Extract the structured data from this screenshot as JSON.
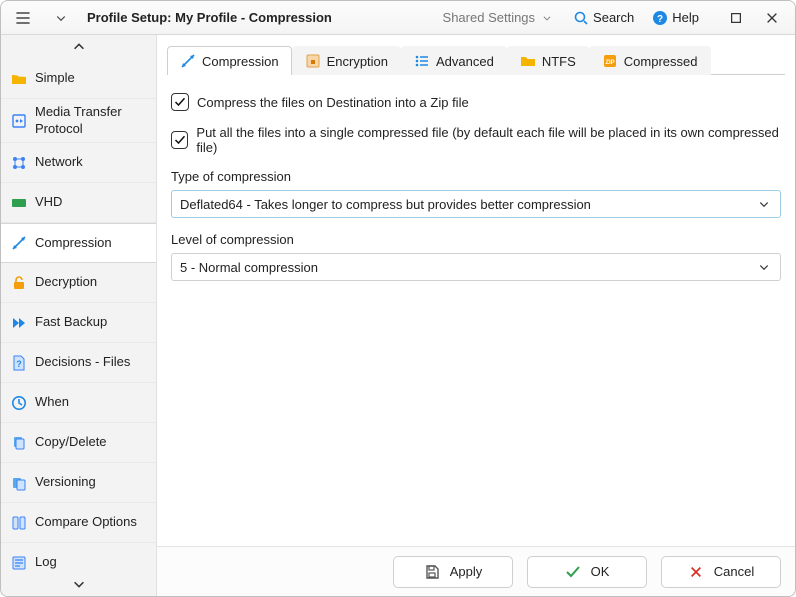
{
  "titlebar": {
    "title": "Profile Setup: My Profile - Compression",
    "shared": "Shared Settings",
    "search": "Search",
    "help": "Help"
  },
  "sidebar": {
    "items": [
      {
        "label": "Simple"
      },
      {
        "label": "Media Transfer Protocol"
      },
      {
        "label": "Network"
      },
      {
        "label": "VHD"
      },
      {
        "label": "Compression"
      },
      {
        "label": "Decryption"
      },
      {
        "label": "Fast Backup"
      },
      {
        "label": "Decisions - Files"
      },
      {
        "label": "When"
      },
      {
        "label": "Copy/Delete"
      },
      {
        "label": "Versioning"
      },
      {
        "label": "Compare Options"
      },
      {
        "label": "Log"
      }
    ]
  },
  "tabs": {
    "compression": "Compression",
    "encryption": "Encryption",
    "advanced": "Advanced",
    "ntfs": "NTFS",
    "compressed": "Compressed"
  },
  "form": {
    "chk1": "Compress the files on Destination into a Zip file",
    "chk2": "Put all the files into a single compressed file (by default each file will be placed in its own compressed file)",
    "type_label": "Type of compression",
    "type_value": "Deflated64 - Takes longer to compress but provides better compression",
    "level_label": "Level of compression",
    "level_value": "5 - Normal compression"
  },
  "footer": {
    "apply": "Apply",
    "ok": "OK",
    "cancel": "Cancel"
  }
}
